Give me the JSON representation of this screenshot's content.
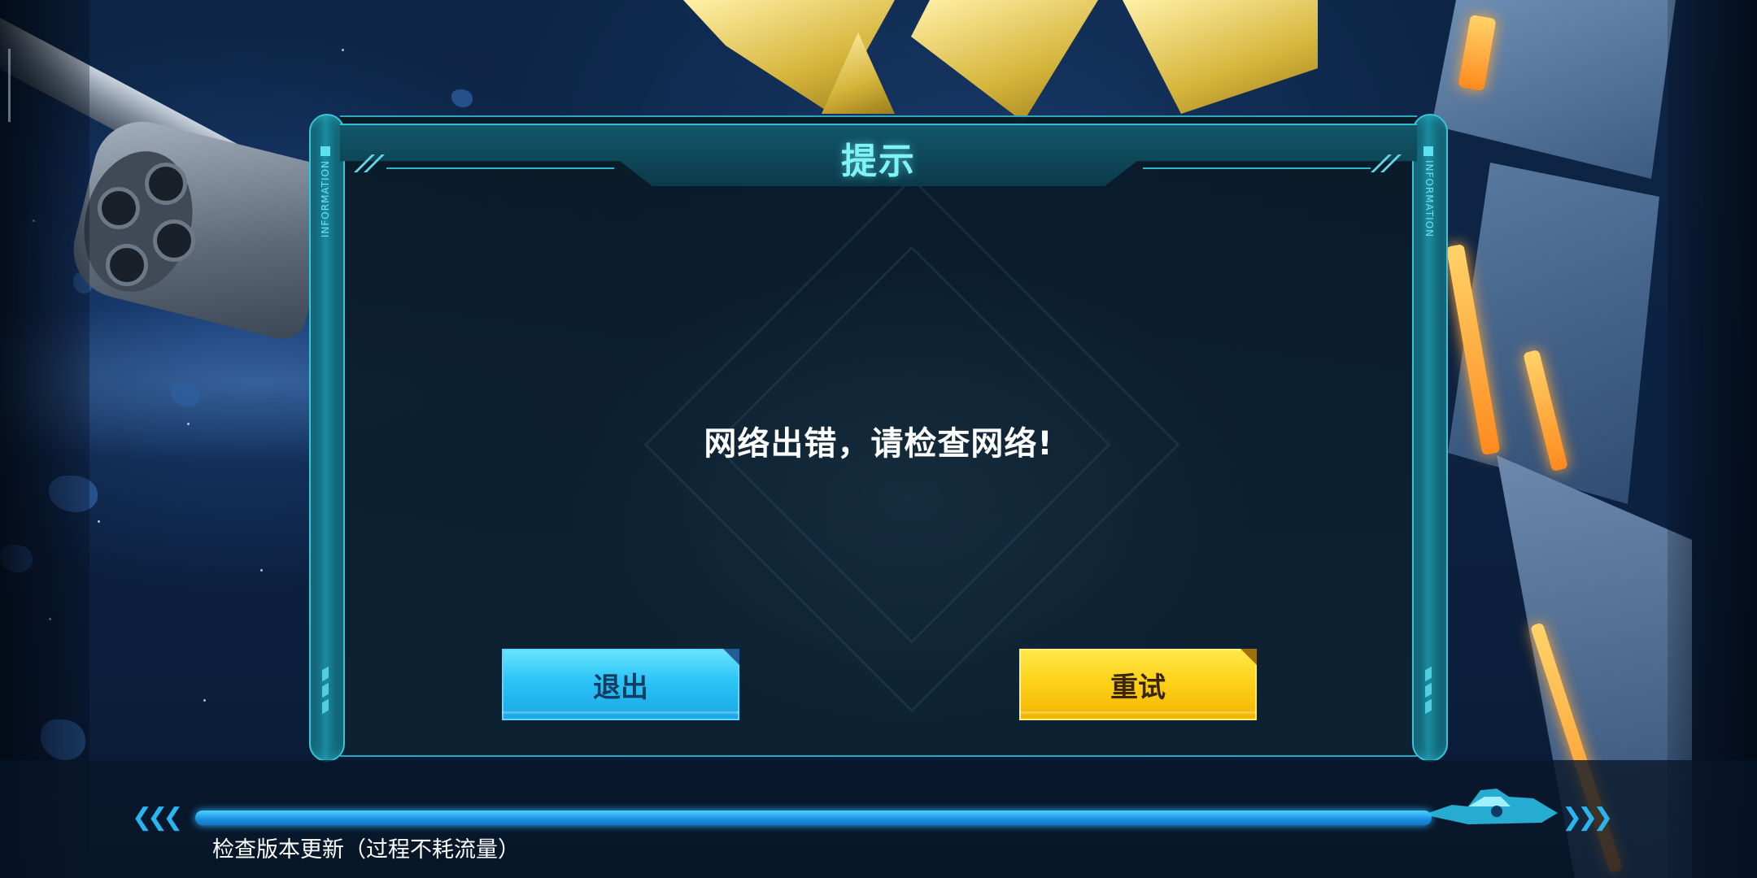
{
  "dialog": {
    "title": "提示",
    "side_label": "INFORMATION",
    "message": "网络出错，请检查网络!",
    "buttons": {
      "exit": "退出",
      "retry": "重试"
    }
  },
  "loading": {
    "status": "检查版本更新（过程不耗流量）",
    "progress": 1.0
  },
  "colors": {
    "accent_cyan": "#35c0d3",
    "title_text": "#7ff3f6",
    "exit_button": "#2cc3f5",
    "retry_button": "#ffd21a",
    "progress_fill": "#1a8fe0"
  }
}
